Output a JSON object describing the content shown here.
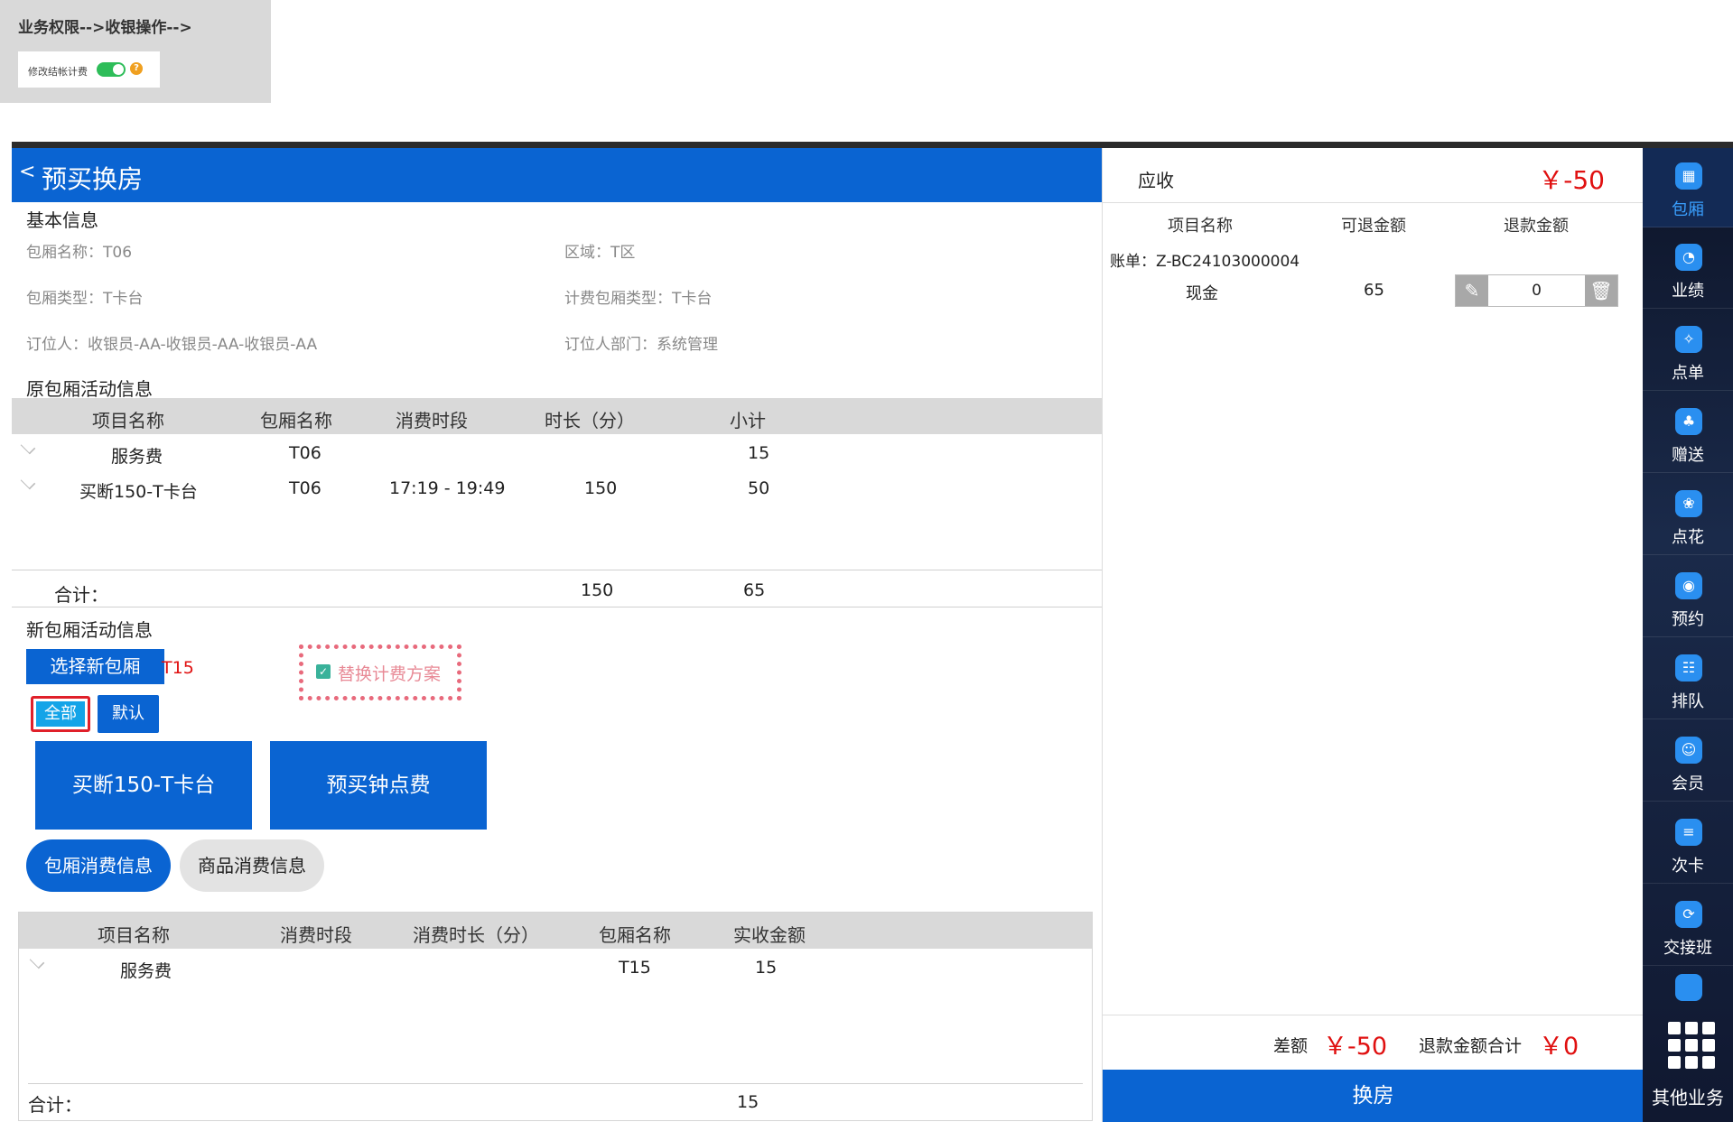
{
  "permission": {
    "title": "业务权限-->收银操作-->",
    "toggle_label": "修改结帐计费",
    "help": "?"
  },
  "header": {
    "back": "<",
    "title": "预买换房"
  },
  "basic_info": {
    "section": "基本信息",
    "room_name": "包厢名称：T06",
    "area": "区域：T区",
    "room_type": "包厢类型：T卡台",
    "billing_type": "计费包厢类型：T卡台",
    "booker": "订位人：收银员-AA-收银员-AA-收银员-AA",
    "dept": "订位人部门：系统管理"
  },
  "orig": {
    "section": "原包厢活动信息",
    "headers": [
      "项目名称",
      "包厢名称",
      "消费时段",
      "时长（分）",
      "小计"
    ],
    "rows": [
      {
        "name": "服务费",
        "room": "T06",
        "period": "",
        "duration": "",
        "subtotal": "15"
      },
      {
        "name": "买断150-T卡台",
        "room": "T06",
        "period": "17:19 - 19:49",
        "duration": "150",
        "subtotal": "50"
      }
    ],
    "total_label": "合计：",
    "total_duration": "150",
    "total_subtotal": "65"
  },
  "new": {
    "section": "新包厢活动信息",
    "select_btn": "选择新包厢",
    "room": "T15",
    "replace_label": "替换计费方案",
    "filter_all": "全部",
    "filter_default": "默认",
    "plans": [
      "买断150-T卡台",
      "预买钟点费"
    ],
    "tab_room": "包厢消费信息",
    "tab_goods": "商品消费信息",
    "headers": [
      "项目名称",
      "消费时段",
      "消费时长（分）",
      "包厢名称",
      "实收金额"
    ],
    "rows": [
      {
        "name": "服务费",
        "period": "",
        "duration": "",
        "room": "T15",
        "amount": "15"
      }
    ],
    "total_label": "合计：",
    "total_amount": "15"
  },
  "right": {
    "receivable_label": "应收",
    "receivable": "￥-50",
    "headers": [
      "项目名称",
      "可退金额",
      "退款金额"
    ],
    "bill": "账单：Z-BC24103000004",
    "row": {
      "name": "现金",
      "refundable": "65",
      "refund": "0"
    },
    "diff_label": "差额",
    "diff": "￥-50",
    "refund_total_label": "退款金额合计",
    "refund_total": "￥0",
    "confirm": "换房"
  },
  "sidebar": {
    "items": [
      {
        "label": "包厢",
        "icon": "grid-icon"
      },
      {
        "label": "业绩",
        "icon": "pie-icon"
      },
      {
        "label": "点单",
        "icon": "order-icon"
      },
      {
        "label": "赠送",
        "icon": "gift-icon"
      },
      {
        "label": "点花",
        "icon": "flower-icon"
      },
      {
        "label": "预约",
        "icon": "reserve-icon"
      },
      {
        "label": "排队",
        "icon": "queue-icon"
      },
      {
        "label": "会员",
        "icon": "member-icon"
      },
      {
        "label": "次卡",
        "icon": "card-icon"
      },
      {
        "label": "交接班",
        "icon": "shift-icon"
      }
    ],
    "other": "其他业务"
  },
  "colors": {
    "primary": "#0a64d2",
    "alert": "#e01010",
    "toggle_on": "#2ebd59"
  }
}
